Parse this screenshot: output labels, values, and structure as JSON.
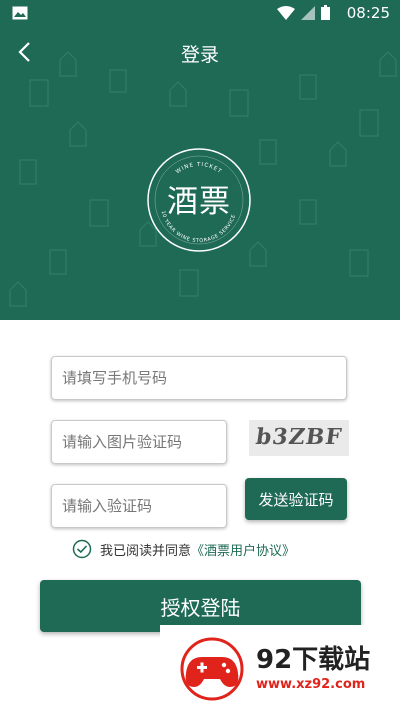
{
  "status_bar": {
    "time": "08:25"
  },
  "header": {
    "title": "登录",
    "logo_text": "酒票",
    "logo_top_arc": "WINE TICKET",
    "logo_bottom_arc": "10 YEAR WINE STORAGE SERVICE"
  },
  "form": {
    "phone_placeholder": "请填写手机号码",
    "image_captcha_placeholder": "请输入图片验证码",
    "captcha_text": "b3ZBF",
    "sms_code_placeholder": "请输入验证码",
    "send_code_label": "发送验证码",
    "agree_text": "我已阅读并同意",
    "agree_link": "《酒票用户协议》",
    "login_label": "授权登陆"
  },
  "watermark": {
    "brand": "92下载站",
    "url": "www.xz92.com"
  },
  "colors": {
    "brand": "#1e6a55",
    "watermark_red": "#e0241b"
  }
}
